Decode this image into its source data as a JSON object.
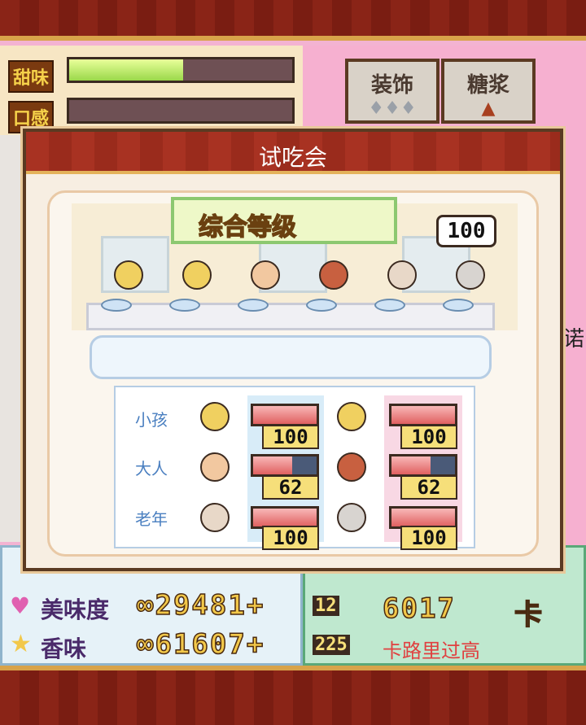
{
  "stats": {
    "sweet_label": "甜味",
    "texture_label": "口感",
    "sweet_level": 0.51,
    "texture_level": 0.0
  },
  "top_buttons": [
    {
      "label": "装饰"
    },
    {
      "label": "糖浆"
    }
  ],
  "side_text": "诺",
  "dialog": {
    "title": "试吃会",
    "level_banner": "综合等级",
    "overall_score": "100",
    "comment": ""
  },
  "scores": {
    "rows": [
      {
        "label": "小孩",
        "a": "100",
        "a_value": 100,
        "b": "100",
        "b_value": 100
      },
      {
        "label": "大人",
        "a": "62",
        "a_value": 62,
        "b": "62",
        "b_value": 62
      },
      {
        "label": "老年",
        "a": "100",
        "a_value": 100,
        "b": "100",
        "b_value": 100
      }
    ]
  },
  "info": {
    "beauty_label": "美味度",
    "beauty_value": "29481",
    "beauty_plus": "12",
    "aroma_label": "香味",
    "aroma_value": "61607",
    "aroma_plus": "225",
    "calories_value": "6017",
    "calories_note": "卡路里过高",
    "calories_unit": "卡"
  },
  "colors": {
    "frame_red": "#8a2417",
    "gold": "#f2c84a",
    "pink_bg": "#f3b3d2",
    "score_blue": "#4a7fc0"
  }
}
